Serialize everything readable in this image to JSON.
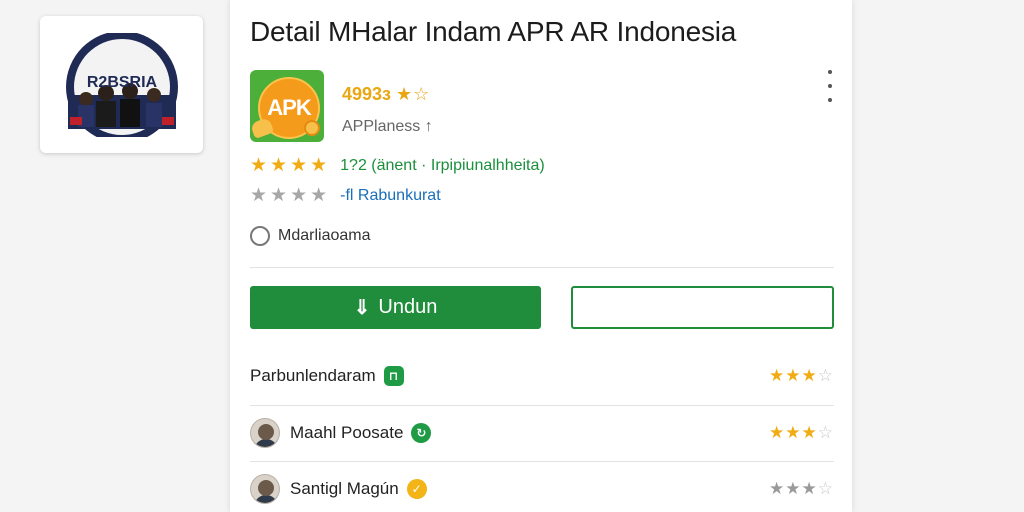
{
  "logo": {
    "text": "R2BSRIA"
  },
  "page": {
    "title": "Detail MHalar Indam APR AR Indonesia"
  },
  "app": {
    "icon_text": "APK",
    "rating_text": "4993з",
    "rating_stars": "★☆",
    "subtitle": "APPlaness ↑",
    "menu_icon": "kebab-icon"
  },
  "stats": {
    "row1": {
      "stars": "★★★★",
      "text": "1?2 (änent · Irpipiunalhheita)"
    },
    "row2": {
      "stars": "★★★★",
      "text": "-fl Rabunkurat"
    }
  },
  "radio": {
    "label": "Mdarliaoama"
  },
  "buttons": {
    "download_label": "Undun",
    "secondary_label": ""
  },
  "colors": {
    "accent_green": "#1f8d3c",
    "star_gold": "#f0ac12",
    "link_blue": "#1a6fb8"
  },
  "reviews": [
    {
      "name": "Parbunlendaram",
      "badge": "⊓",
      "badge_color": "green",
      "stars": "★★★☆",
      "has_avatar": false
    },
    {
      "name": "Maahl Poosate",
      "badge": "↻",
      "badge_color": "green",
      "stars": "★★★☆",
      "has_avatar": true
    },
    {
      "name": "Santigl Magún",
      "badge": "✓",
      "badge_color": "gold",
      "stars": "★★★☆",
      "has_avatar": true
    }
  ]
}
